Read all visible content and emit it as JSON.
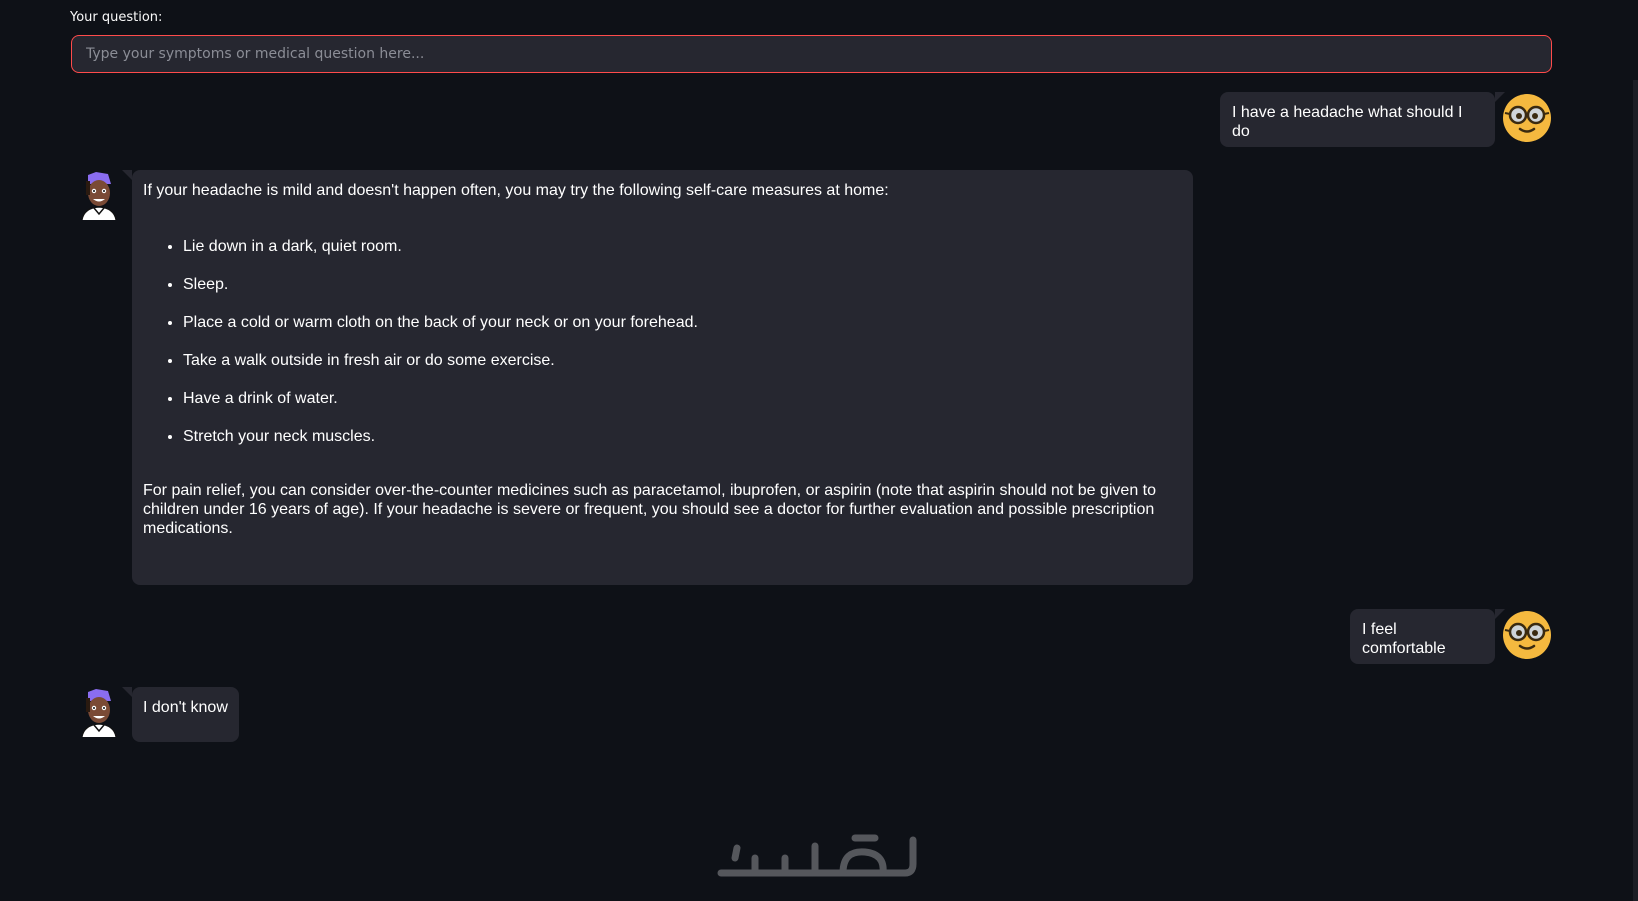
{
  "question": {
    "label": "Your question:",
    "placeholder": "Type your symptoms or medical question here...",
    "value": ""
  },
  "messages": [
    {
      "role": "user",
      "text": "I have a headache what should I do"
    },
    {
      "role": "bot",
      "intro": "If your headache is mild and doesn't happen often, you may try the following self-care measures at home:",
      "bullets": [
        "Lie down in a dark, quiet room.",
        "Sleep.",
        "Place a cold or warm cloth on the back of your neck or on your forehead.",
        "Take a walk outside in fresh air or do some exercise.",
        "Have a drink of water.",
        "Stretch your neck muscles."
      ],
      "outro": "For pain relief, you can consider over-the-counter medicines such as paracetamol, ibuprofen, or aspirin (note that aspirin should not be given to children under 16 years of age). If your headache is severe or frequent, you should see a doctor for further evaluation and possible prescription medications."
    },
    {
      "role": "user",
      "text": "I feel comfortable"
    },
    {
      "role": "bot",
      "text": "I don't know"
    }
  ],
  "icons": {
    "user_avatar": "nerd-face-glasses-icon",
    "bot_avatar": "cartoon-person-purple-hair-icon",
    "watermark": "persian-logo-watermark"
  },
  "colors": {
    "background": "#0e1117",
    "bubble": "#262730",
    "input_border": "#ff4b4b",
    "user_avatar": "#f5b93f"
  }
}
